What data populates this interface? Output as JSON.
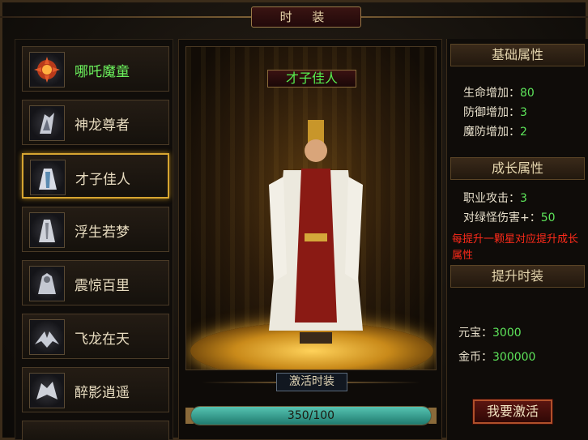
{
  "window": {
    "title": "时 装"
  },
  "outfits": [
    {
      "label": "哪吒魔童",
      "icon": "demon-child-icon",
      "active": true,
      "selected": false
    },
    {
      "label": "神龙尊者",
      "icon": "dragon-lord-icon",
      "active": false,
      "selected": false
    },
    {
      "label": "才子佳人",
      "icon": "scholar-icon",
      "active": false,
      "selected": true
    },
    {
      "label": "浮生若梦",
      "icon": "dream-icon",
      "active": false,
      "selected": false
    },
    {
      "label": "震惊百里",
      "icon": "thunder-icon",
      "active": false,
      "selected": false
    },
    {
      "label": "飞龙在天",
      "icon": "flying-dragon-icon",
      "active": false,
      "selected": false
    },
    {
      "label": "醉影逍遥",
      "icon": "drunk-shadow-icon",
      "active": false,
      "selected": false
    }
  ],
  "preview": {
    "name": "才子佳人",
    "activate_label": "激活时装",
    "progress_text": "350/100",
    "progress_fraction": 1.0
  },
  "base_attrs": {
    "title": "基础属性",
    "items": [
      {
        "label": "生命增加：",
        "value": "80"
      },
      {
        "label": "防御增加：",
        "value": "3"
      },
      {
        "label": "魔防增加：",
        "value": "2"
      }
    ]
  },
  "growth_attrs": {
    "title": "成长属性",
    "items": [
      {
        "label": "职业攻击：",
        "value": "3"
      },
      {
        "label": "对绿怪伤害+：",
        "value": "50"
      }
    ],
    "note": "每提升一颗星对应提升成长属性"
  },
  "upgrade": {
    "title": "提升时装",
    "costs": [
      {
        "label": "元宝：",
        "value": "3000"
      },
      {
        "label": "金币：",
        "value": "300000"
      }
    ],
    "button": "我要激活"
  },
  "colors": {
    "green": "#5de45a",
    "gold": "#d7a531",
    "red_note": "#ff2a1a"
  }
}
